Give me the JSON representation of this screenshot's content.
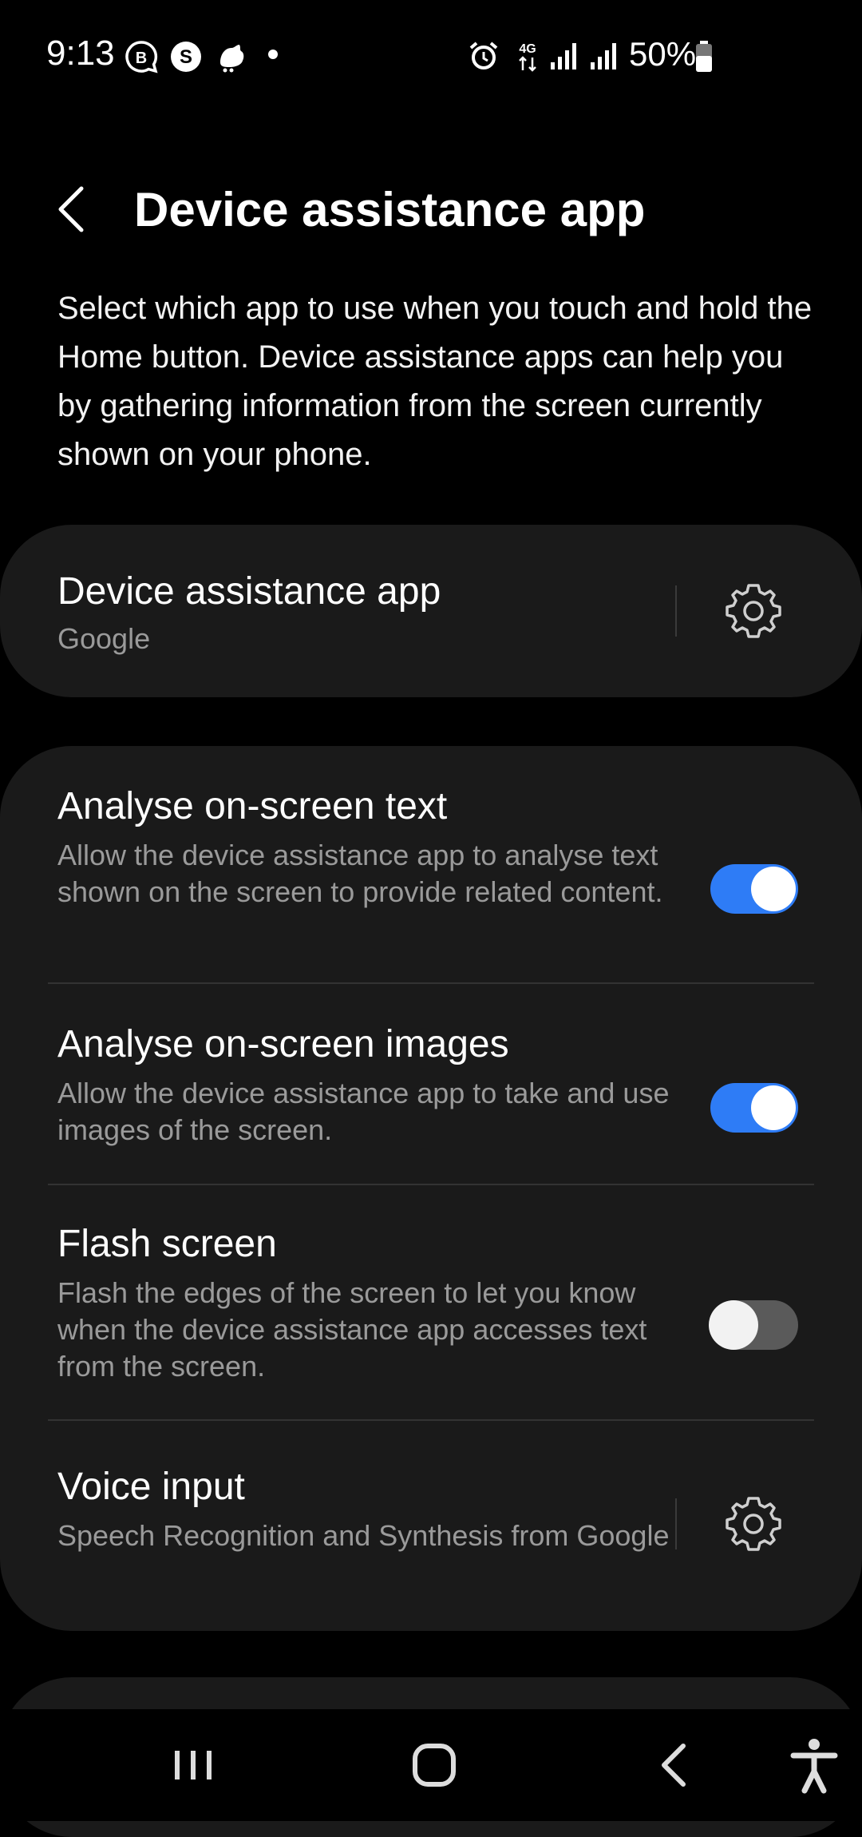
{
  "status_bar": {
    "time": "9:13",
    "battery": "50%",
    "network": "4G",
    "icons": [
      "b-chat-icon",
      "s-icon",
      "app-icon",
      "dot-icon",
      "alarm-icon",
      "4g-icon",
      "signal-icon",
      "signal-icon",
      "battery-icon"
    ]
  },
  "header": {
    "title": "Device assistance app"
  },
  "intro": "Select which app to use when you touch and hold the Home button. Device assistance apps can help you by gathering information from the screen currently shown on your phone.",
  "assistant_app": {
    "title": "Device assistance app",
    "value": "Google"
  },
  "settings": {
    "analyse_text": {
      "title": "Analyse on-screen text",
      "description": "Allow the device assistance app to analyse text shown on the screen to provide related content.",
      "enabled": true
    },
    "analyse_images": {
      "title": "Analyse on-screen images",
      "description": "Allow the device assistance app to take and use images of the screen.",
      "enabled": true
    },
    "flash_screen": {
      "title": "Flash screen",
      "description": "Flash the edges of the screen to let you know when the device assistance app accesses text from the screen.",
      "enabled": false
    },
    "voice_input": {
      "title": "Voice input",
      "description": "Speech Recognition and Synthesis from Google"
    }
  },
  "colors": {
    "accent": "#2e7cf6",
    "card": "#1a1a1a",
    "background": "#000000",
    "secondary_text": "#9a9a9a"
  }
}
